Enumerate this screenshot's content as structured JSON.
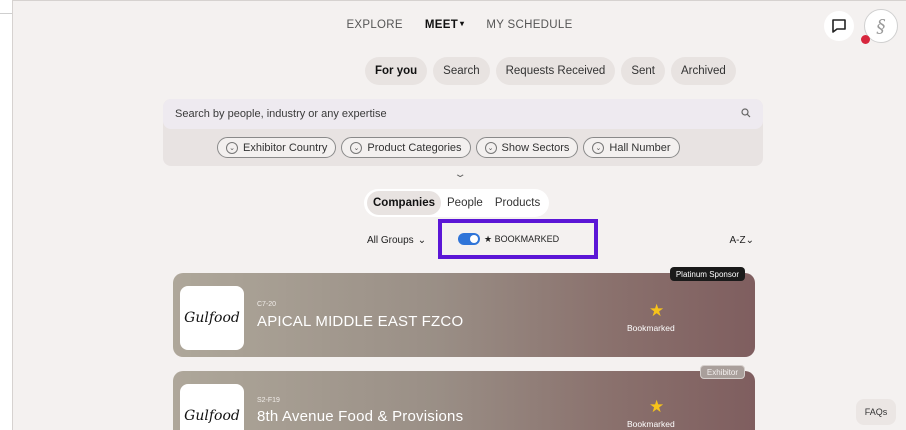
{
  "nav": {
    "items": [
      {
        "label": "EXPLORE",
        "active": false
      },
      {
        "label": "MEET",
        "active": true,
        "caret": "▾"
      },
      {
        "label": "MY SCHEDULE",
        "active": false
      }
    ],
    "chat_icon": "chat-bubble-icon"
  },
  "subtabs": [
    {
      "label": "For you",
      "active": true
    },
    {
      "label": "Search",
      "active": false
    },
    {
      "label": "Requests Received",
      "active": false
    },
    {
      "label": "Sent",
      "active": false
    },
    {
      "label": "Archived",
      "active": false
    }
  ],
  "search": {
    "placeholder": "Search by people, industry or any expertise",
    "value": ""
  },
  "filters": [
    {
      "label": "Exhibitor Country"
    },
    {
      "label": "Product Categories"
    },
    {
      "label": "Show Sectors"
    },
    {
      "label": "Hall Number"
    }
  ],
  "type_toggle": [
    {
      "label": "Companies",
      "active": true
    },
    {
      "label": "People",
      "active": false
    },
    {
      "label": "Products",
      "active": false
    }
  ],
  "groups_label": "All Groups",
  "bookmarked_toggle": {
    "label": "★ BOOKMARKED",
    "on": true,
    "highlight_color": "#5b16d6"
  },
  "sort_label": "A-Z",
  "cards": [
    {
      "badge": "Platinum Sponsor",
      "logo_text": "Gulfood",
      "booth": "C7-20",
      "name": "APICAL MIDDLE EAST FZCO",
      "bookmark_label": "Bookmarked"
    },
    {
      "badge": "Exhibitor",
      "logo_text": "Gulfood",
      "booth": "S2-F19",
      "name": "8th Avenue Food & Provisions",
      "bookmark_label": "Bookmarked"
    }
  ],
  "faqs_label": "FAQs",
  "colors": {
    "accent": "#5b16d6",
    "toggle_on": "#2f74d8",
    "star": "#f6c31a",
    "notification": "#d7263d"
  }
}
